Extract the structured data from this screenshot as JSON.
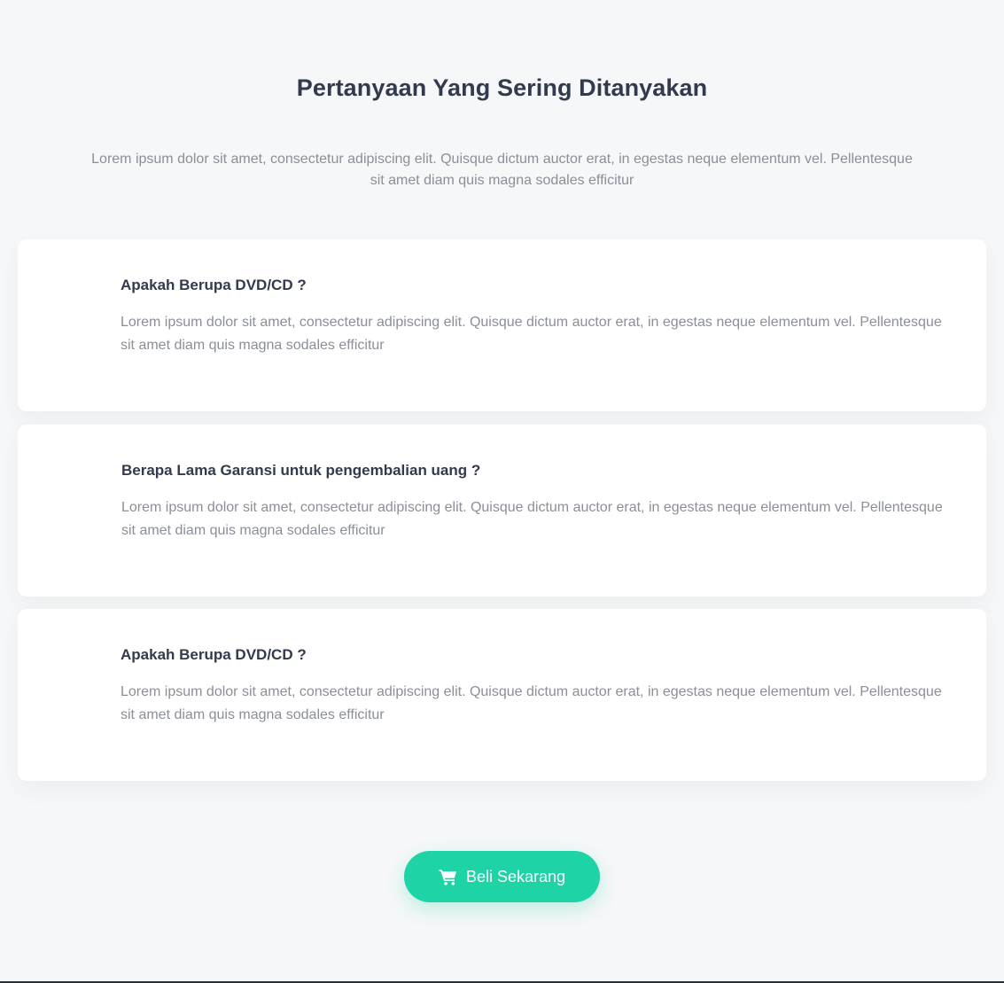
{
  "faq": {
    "title": "Pertanyaan Yang Sering Ditanyakan",
    "subtitle": "Lorem ipsum dolor sit amet, consectetur adipiscing elit. Quisque dictum auctor erat, in egestas neque elementum vel. Pellentesque sit amet diam quis magna sodales efficitur",
    "items": [
      {
        "question": "Apakah Berupa DVD/CD ?",
        "answer": "Lorem ipsum dolor sit amet, consectetur adipiscing elit. Quisque dictum auctor erat, in egestas neque elementum vel. Pellentesque sit amet diam quis magna sodales efficitur"
      },
      {
        "question": "Berapa Lama Garansi untuk pengembalian uang ?",
        "answer": "Lorem ipsum dolor sit amet, consectetur adipiscing elit. Quisque dictum auctor erat, in egestas neque elementum vel. Pellentesque sit amet diam quis magna sodales efficitur"
      },
      {
        "question": "Apakah Berupa DVD/CD ?",
        "answer": "Lorem ipsum dolor sit amet, consectetur adipiscing elit. Quisque dictum auctor erat, in egestas neque elementum vel. Pellentesque sit amet diam quis magna sodales efficitur"
      }
    ]
  },
  "cta": {
    "label": "Beli Sekarang",
    "icon": "shopping-cart-icon"
  },
  "colors": {
    "accent": "#1ed3a6",
    "heading": "#343a4e",
    "body_text": "#8a8f98",
    "background": "#f5f7f8"
  }
}
